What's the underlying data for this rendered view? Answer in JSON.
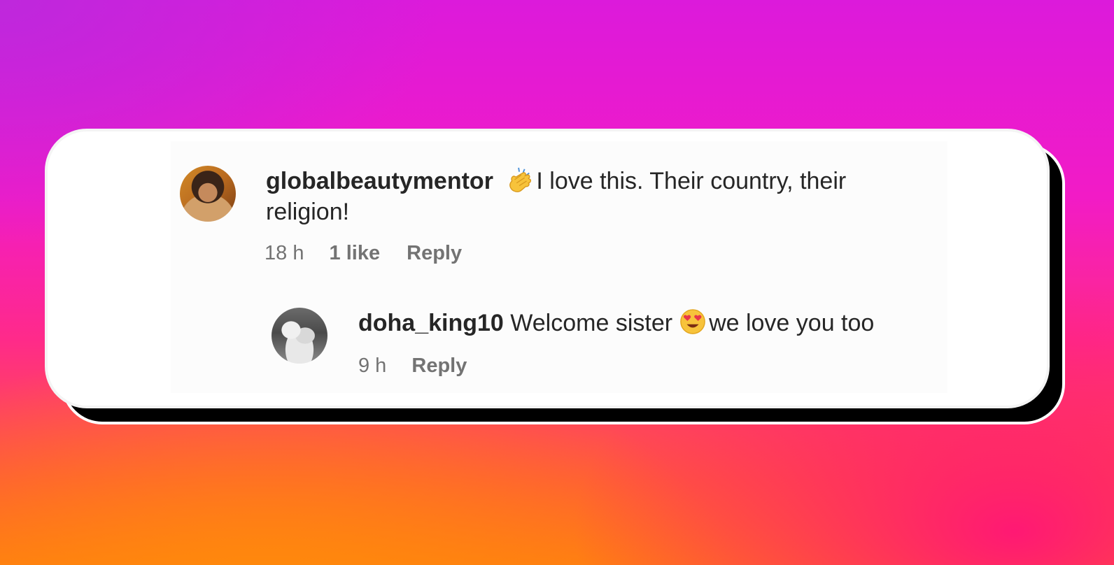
{
  "comments": [
    {
      "username": "globalbeautymentor",
      "emoji": "clapping-hands",
      "text": "I love this. Their country, their religion!",
      "time": "18 h",
      "likes": "1 like",
      "reply": "Reply"
    }
  ],
  "replies": [
    {
      "username": "doha_king10",
      "text_before": "Welcome sister",
      "emoji": "heart-eyes-face",
      "text_after": "we love you too",
      "time": "9 h",
      "reply": "Reply"
    }
  ],
  "colors": {
    "text": "#262626",
    "meta": "#737373",
    "card": "#ffffff",
    "shadow": "#000000"
  }
}
